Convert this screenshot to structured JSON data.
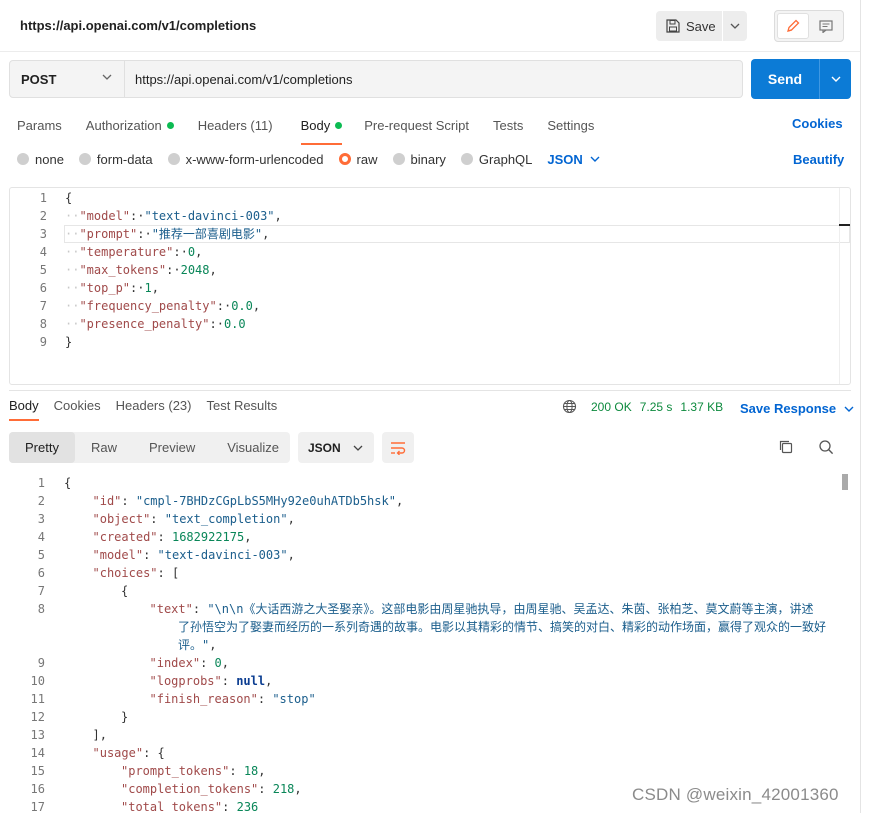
{
  "header": {
    "title": "https://api.openai.com/v1/completions",
    "save_label": "Save"
  },
  "request": {
    "method": "POST",
    "url": "https://api.openai.com/v1/completions",
    "send_label": "Send"
  },
  "tabs": {
    "params": "Params",
    "authorization": "Authorization",
    "headers": "Headers (11)",
    "body": "Body",
    "prerequest": "Pre-request Script",
    "tests": "Tests",
    "settings": "Settings",
    "cookies": "Cookies"
  },
  "body_types": {
    "none": "none",
    "form_data": "form-data",
    "urlencoded": "x-www-form-urlencoded",
    "raw": "raw",
    "binary": "binary",
    "graphql": "GraphQL",
    "format": "JSON",
    "beautify": "Beautify"
  },
  "request_body_lines": [
    {
      "n": "1",
      "tokens": [
        {
          "t": "{",
          "c": "p"
        }
      ]
    },
    {
      "n": "2",
      "tokens": [
        {
          "t": "··",
          "c": "g"
        },
        {
          "t": "\"model\"",
          "c": "k"
        },
        {
          "t": ":·",
          "c": "p"
        },
        {
          "t": "\"text-davinci-003\"",
          "c": "s"
        },
        {
          "t": ",",
          "c": "p"
        }
      ]
    },
    {
      "n": "3",
      "tokens": [
        {
          "t": "··",
          "c": "g"
        },
        {
          "t": "\"prompt\"",
          "c": "k"
        },
        {
          "t": ":·",
          "c": "p"
        },
        {
          "t": "\"推荐一部喜剧电影\"",
          "c": "s"
        },
        {
          "t": ",",
          "c": "p"
        }
      ]
    },
    {
      "n": "4",
      "tokens": [
        {
          "t": "··",
          "c": "g"
        },
        {
          "t": "\"temperature\"",
          "c": "k"
        },
        {
          "t": ":·",
          "c": "p"
        },
        {
          "t": "0",
          "c": "n"
        },
        {
          "t": ",",
          "c": "p"
        }
      ]
    },
    {
      "n": "5",
      "tokens": [
        {
          "t": "··",
          "c": "g"
        },
        {
          "t": "\"max_tokens\"",
          "c": "k"
        },
        {
          "t": ":·",
          "c": "p"
        },
        {
          "t": "2048",
          "c": "n"
        },
        {
          "t": ",",
          "c": "p"
        }
      ]
    },
    {
      "n": "6",
      "tokens": [
        {
          "t": "··",
          "c": "g"
        },
        {
          "t": "\"top_p\"",
          "c": "k"
        },
        {
          "t": ":·",
          "c": "p"
        },
        {
          "t": "1",
          "c": "n"
        },
        {
          "t": ",",
          "c": "p"
        }
      ]
    },
    {
      "n": "7",
      "tokens": [
        {
          "t": "··",
          "c": "g"
        },
        {
          "t": "\"frequency_penalty\"",
          "c": "k"
        },
        {
          "t": ":·",
          "c": "p"
        },
        {
          "t": "0.0",
          "c": "n"
        },
        {
          "t": ",",
          "c": "p"
        }
      ]
    },
    {
      "n": "8",
      "tokens": [
        {
          "t": "··",
          "c": "g"
        },
        {
          "t": "\"presence_penalty\"",
          "c": "k"
        },
        {
          "t": ":·",
          "c": "p"
        },
        {
          "t": "0.0",
          "c": "n"
        }
      ]
    },
    {
      "n": "9",
      "tokens": [
        {
          "t": "}",
          "c": "p"
        }
      ]
    }
  ],
  "response": {
    "tabs": {
      "body": "Body",
      "cookies": "Cookies",
      "headers": "Headers (23)",
      "test_results": "Test Results"
    },
    "status": "200 OK",
    "time": "7.25 s",
    "size": "1.37 KB",
    "save_response": "Save Response",
    "views": {
      "pretty": "Pretty",
      "raw": "Raw",
      "preview": "Preview",
      "visualize": "Visualize"
    },
    "format": "JSON"
  },
  "response_body_lines": [
    {
      "n": "1",
      "indent": 0,
      "tokens": [
        {
          "t": "{",
          "c": "p"
        }
      ]
    },
    {
      "n": "2",
      "indent": 1,
      "tokens": [
        {
          "t": "\"id\"",
          "c": "k"
        },
        {
          "t": ": ",
          "c": "p"
        },
        {
          "t": "\"cmpl-7BHDzCGpLbS5MHy92e0uhATDb5hsk\"",
          "c": "s"
        },
        {
          "t": ",",
          "c": "p"
        }
      ]
    },
    {
      "n": "3",
      "indent": 1,
      "tokens": [
        {
          "t": "\"object\"",
          "c": "k"
        },
        {
          "t": ": ",
          "c": "p"
        },
        {
          "t": "\"text_completion\"",
          "c": "s"
        },
        {
          "t": ",",
          "c": "p"
        }
      ]
    },
    {
      "n": "4",
      "indent": 1,
      "tokens": [
        {
          "t": "\"created\"",
          "c": "k"
        },
        {
          "t": ": ",
          "c": "p"
        },
        {
          "t": "1682922175",
          "c": "n"
        },
        {
          "t": ",",
          "c": "p"
        }
      ]
    },
    {
      "n": "5",
      "indent": 1,
      "tokens": [
        {
          "t": "\"model\"",
          "c": "k"
        },
        {
          "t": ": ",
          "c": "p"
        },
        {
          "t": "\"text-davinci-003\"",
          "c": "s"
        },
        {
          "t": ",",
          "c": "p"
        }
      ]
    },
    {
      "n": "6",
      "indent": 1,
      "tokens": [
        {
          "t": "\"choices\"",
          "c": "k"
        },
        {
          "t": ": [",
          "c": "p"
        }
      ]
    },
    {
      "n": "7",
      "indent": 2,
      "tokens": [
        {
          "t": "{",
          "c": "p"
        }
      ]
    },
    {
      "n": "8",
      "indent": 3,
      "tokens": [
        {
          "t": "\"text\"",
          "c": "k"
        },
        {
          "t": ": ",
          "c": "p"
        },
        {
          "t": "\"\\n\\n《大话西游之大圣娶亲》。这部电影由周星驰执导，由周星驰、吴孟达、朱茵、张柏芝、莫文蔚等主演，讲述",
          "c": "s"
        }
      ]
    },
    {
      "n": "",
      "indent": 4,
      "tokens": [
        {
          "t": "了孙悟空为了娶妻而经历的一系列奇遇的故事。电影以其精彩的情节、搞笑的对白、精彩的动作场面，赢得了观众的一致好",
          "c": "s"
        }
      ]
    },
    {
      "n": "",
      "indent": 4,
      "tokens": [
        {
          "t": "评。\"",
          "c": "s"
        },
        {
          "t": ",",
          "c": "p"
        }
      ]
    },
    {
      "n": "9",
      "indent": 3,
      "tokens": [
        {
          "t": "\"index\"",
          "c": "k"
        },
        {
          "t": ": ",
          "c": "p"
        },
        {
          "t": "0",
          "c": "n"
        },
        {
          "t": ",",
          "c": "p"
        }
      ]
    },
    {
      "n": "10",
      "indent": 3,
      "tokens": [
        {
          "t": "\"logprobs\"",
          "c": "k"
        },
        {
          "t": ": ",
          "c": "p"
        },
        {
          "t": "null",
          "c": "b"
        },
        {
          "t": ",",
          "c": "p"
        }
      ]
    },
    {
      "n": "11",
      "indent": 3,
      "tokens": [
        {
          "t": "\"finish_reason\"",
          "c": "k"
        },
        {
          "t": ": ",
          "c": "p"
        },
        {
          "t": "\"stop\"",
          "c": "s"
        }
      ]
    },
    {
      "n": "12",
      "indent": 2,
      "tokens": [
        {
          "t": "}",
          "c": "p"
        }
      ]
    },
    {
      "n": "13",
      "indent": 1,
      "tokens": [
        {
          "t": "],",
          "c": "p"
        }
      ]
    },
    {
      "n": "14",
      "indent": 1,
      "tokens": [
        {
          "t": "\"usage\"",
          "c": "k"
        },
        {
          "t": ": {",
          "c": "p"
        }
      ]
    },
    {
      "n": "15",
      "indent": 2,
      "tokens": [
        {
          "t": "\"prompt_tokens\"",
          "c": "k"
        },
        {
          "t": ": ",
          "c": "p"
        },
        {
          "t": "18",
          "c": "n"
        },
        {
          "t": ",",
          "c": "p"
        }
      ]
    },
    {
      "n": "16",
      "indent": 2,
      "tokens": [
        {
          "t": "\"completion_tokens\"",
          "c": "k"
        },
        {
          "t": ": ",
          "c": "p"
        },
        {
          "t": "218",
          "c": "n"
        },
        {
          "t": ",",
          "c": "p"
        }
      ]
    },
    {
      "n": "17",
      "indent": 2,
      "tokens": [
        {
          "t": "\"total_tokens\"",
          "c": "k"
        },
        {
          "t": ": ",
          "c": "p"
        },
        {
          "t": "236",
          "c": "n"
        }
      ]
    }
  ],
  "watermark": "CSDN @weixin_42001360",
  "colors": {
    "accent": "#ff6c37",
    "send": "#0c7bd6",
    "link": "#0265d2",
    "ok": "#0d8a3e"
  }
}
